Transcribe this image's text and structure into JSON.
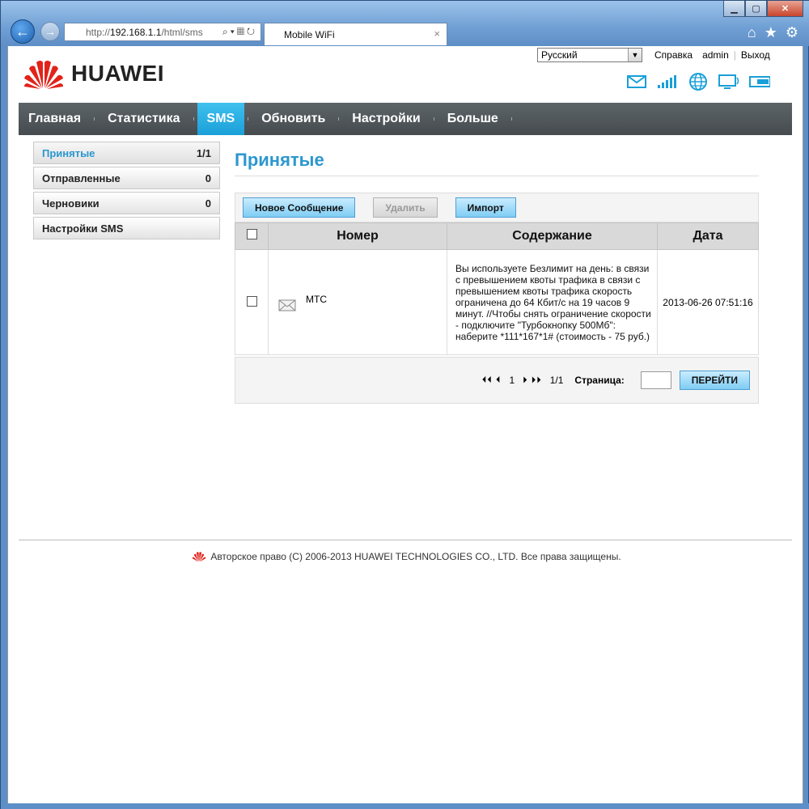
{
  "browser": {
    "address_prefix": "http://",
    "address_host": "192.168.1.1",
    "address_path": "/html/sms",
    "tab_title": "Mobile WiFi",
    "tab_close": "×"
  },
  "header": {
    "language": "Русский",
    "help": "Справка",
    "user": "admin",
    "logout": "Выход",
    "logo_text": "HUAWEI"
  },
  "menu": {
    "items": [
      {
        "label": "Главная"
      },
      {
        "label": "Статистика"
      },
      {
        "label": "SMS"
      },
      {
        "label": "Обновить"
      },
      {
        "label": "Настройки"
      },
      {
        "label": "Больше"
      }
    ],
    "active_index": 2
  },
  "sidebar": {
    "items": [
      {
        "label": "Принятые",
        "count": "1/1"
      },
      {
        "label": "Отправленные",
        "count": "0"
      },
      {
        "label": "Черновики",
        "count": "0"
      },
      {
        "label": "Настройки SMS",
        "count": ""
      }
    ]
  },
  "main": {
    "title": "Принятые",
    "toolbar": {
      "new_message": "Новое Сообщение",
      "delete": "Удалить",
      "import": "Импорт"
    },
    "table": {
      "headers": [
        "Номер",
        "Содержание",
        "Дата"
      ],
      "rows": [
        {
          "number": "MTC",
          "content": "Вы используете Безлимит на день: в связи с превышением квоты трафика в связи с превышением квоты трафика скорость ограничена до 64 Кбит/с на 19 часов 9 минут. //Чтобы снять ограничение скорости - подключите \"Турбокнопку 500Мб\": наберите *111*167*1# (стоимость - 75 руб.)",
          "date": "2013-06-26 07:51:16"
        }
      ]
    },
    "pager": {
      "first_prev": "⏴⏴ ⏴",
      "current": "1",
      "next_last": "⏵ ⏵⏵",
      "total": "1/1",
      "page_label": "Страница:",
      "go": "ПЕРЕЙТИ"
    }
  },
  "footer": {
    "copyright": "Авторское право (C) 2006-2013 HUAWEI TECHNOLOGIES CO., LTD. Все права защищены."
  },
  "colors": {
    "accent": "#2b97cf",
    "menu_active": "#1a9fd8",
    "brand_red": "#e2231a"
  }
}
